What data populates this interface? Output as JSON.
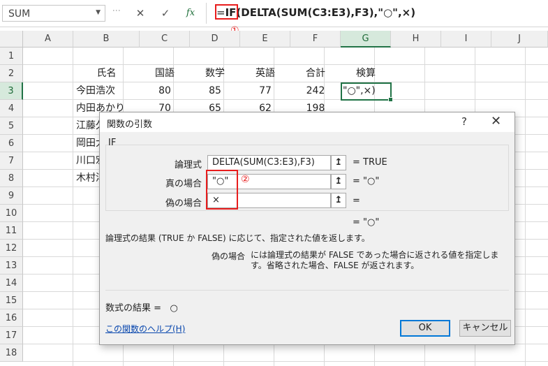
{
  "formula_bar": {
    "name_box": "SUM",
    "cancel_glyph": "✕",
    "enter_glyph": "✓",
    "fx_label": "fx",
    "formula_prefix": "=",
    "formula_fn": "IF",
    "formula_open": "(",
    "formula_rest": "DELTA(SUM(C3:E3),F3),\"○\",×)",
    "annotation_1": "①"
  },
  "columns": [
    "A",
    "B",
    "C",
    "D",
    "E",
    "F",
    "G",
    "H",
    "I",
    "J"
  ],
  "rows": [
    "1",
    "2",
    "3",
    "4",
    "5",
    "6",
    "7",
    "8",
    "9",
    "10",
    "11",
    "12",
    "13",
    "14",
    "15",
    "16",
    "17",
    "18"
  ],
  "sheet": {
    "headers": {
      "name": "氏名",
      "kokugo": "国語",
      "sugaku": "数学",
      "eigo": "英語",
      "gokei": "合計",
      "kenzan": "検算"
    },
    "row3": {
      "name": "今田浩次",
      "c": "80",
      "d": "85",
      "e": "77",
      "f": "242",
      "g": "\"○\",×)"
    },
    "row4": {
      "name": "内田あかり",
      "c": "70",
      "d": "65",
      "e": "62",
      "f": "198"
    },
    "row5": {
      "name": "江藤久"
    },
    "row6": {
      "name": "岡田大"
    },
    "row7": {
      "name": "川口宏"
    },
    "row8": {
      "name": "木村洋"
    }
  },
  "dialog": {
    "title": "関数の引数",
    "help_glyph": "?",
    "close_glyph": "✕",
    "function_name": "IF",
    "args": [
      {
        "label": "論理式",
        "value": "DELTA(SUM(C3:E3),F3)",
        "result": "=  TRUE"
      },
      {
        "label": "真の場合",
        "value": "\"○\"",
        "result": "=  \"○\""
      },
      {
        "label": "偽の場合",
        "value": "×",
        "result": "="
      }
    ],
    "annotation_2": "②",
    "full_result": "=  \"○\"",
    "description": "論理式の結果 (TRUE か FALSE) に応じて、指定された値を返します。",
    "arg_desc_name": "偽の場合",
    "arg_desc_text": "には論理式の結果が FALSE であった場合に返される値を指定します。省略された場合、FALSE が返されます。",
    "formula_result_label": "数式の結果 =",
    "formula_result_value": "○",
    "help_link": "この関数のヘルプ(H)",
    "ok_label": "OK",
    "cancel_label": "キャンセル"
  }
}
